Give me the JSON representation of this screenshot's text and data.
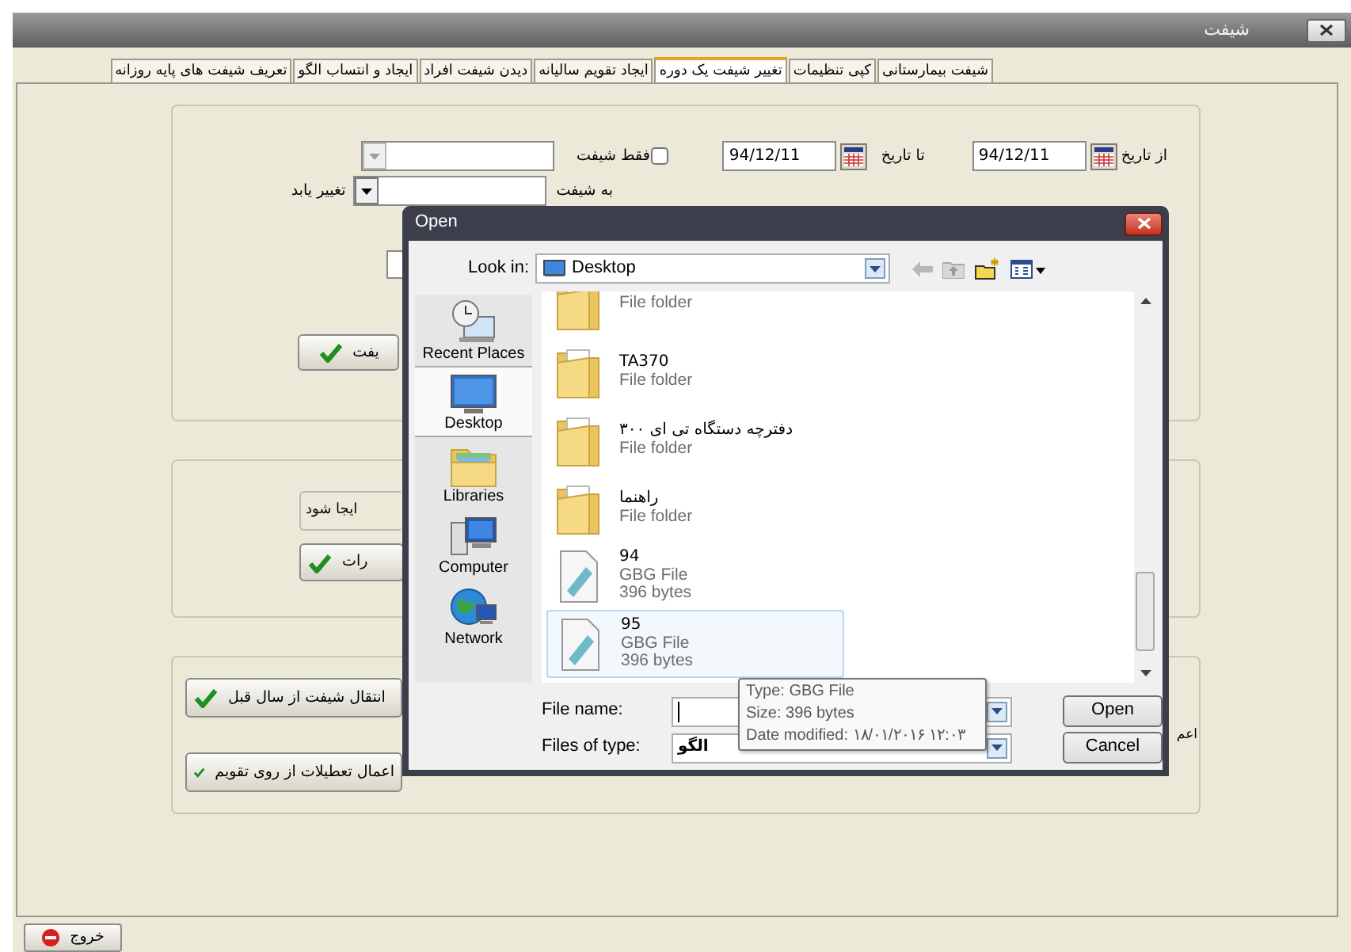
{
  "window": {
    "title": "شیفت"
  },
  "tabs": [
    {
      "label": "شیفت بیمارستانی",
      "selected": false
    },
    {
      "label": "کپی تنظیمات",
      "selected": false
    },
    {
      "label": "تغییر شیفت یک دوره",
      "selected": true
    },
    {
      "label": "ایجاد تقویم سالیانه",
      "selected": false
    },
    {
      "label": "دیدن شیفت افراد",
      "selected": false
    },
    {
      "label": "ایجاد و انتساب الگو",
      "selected": false
    },
    {
      "label": "تعریف شیفت های پایه روزانه",
      "selected": false
    }
  ],
  "period_form": {
    "from_label": "از تاریخ",
    "from_date": "94/12/11",
    "to_label": "تا تاریخ",
    "to_date": "94/12/11",
    "only_shift": {
      "label": "فقط شیفت",
      "checked": false
    },
    "shift_combo": {
      "disabled": true
    },
    "to_shift_label": "به شیفت",
    "to_shift_combo": {
      "disabled": false
    },
    "change_label": "تغییر یابد",
    "apply_button": "یفت"
  },
  "create_group": {
    "field_text": "ایجا شود",
    "button": "رات"
  },
  "transfer_group": {
    "buttons": [
      "انتقال شیفت از سال قبل",
      "اعمال تعطیلات از روی تقویم"
    ],
    "side_label": "اعم"
  },
  "exit_button": "خروج",
  "open_dialog": {
    "title": "Open",
    "look_in_label": "Look in:",
    "look_in_value": "Desktop",
    "places": [
      {
        "label": "Recent Places",
        "selected": false
      },
      {
        "label": "Desktop",
        "selected": true
      },
      {
        "label": "Libraries",
        "selected": false
      },
      {
        "label": "Computer",
        "selected": false
      },
      {
        "label": "Network",
        "selected": false
      }
    ],
    "files": [
      {
        "kind": "folder",
        "type": "File folder",
        "selected": false
      },
      {
        "kind": "folder",
        "name": "TA370",
        "type": "File folder",
        "selected": false
      },
      {
        "kind": "folder",
        "name": "دفترچه دستگاه تی ای ۳۰۰",
        "type": "File folder",
        "selected": false
      },
      {
        "kind": "folder",
        "name": "راهنما",
        "type": "File folder",
        "selected": false
      },
      {
        "kind": "file",
        "name": "94",
        "type": "GBG File",
        "size": "396 bytes",
        "selected": false
      },
      {
        "kind": "file",
        "name": "95",
        "type": "GBG File",
        "size": "396 bytes",
        "selected": true
      }
    ],
    "file_name_label": "File name:",
    "files_of_type_label": "Files of type:",
    "files_of_type_value": "الگو",
    "buttons": [
      "Open",
      "Cancel"
    ],
    "tooltip": [
      "Type: GBG File",
      "Size: 396 bytes",
      "Date modified: ۱۸/۰۱/۲۰۱۶ ۱۲:۰۳"
    ]
  }
}
